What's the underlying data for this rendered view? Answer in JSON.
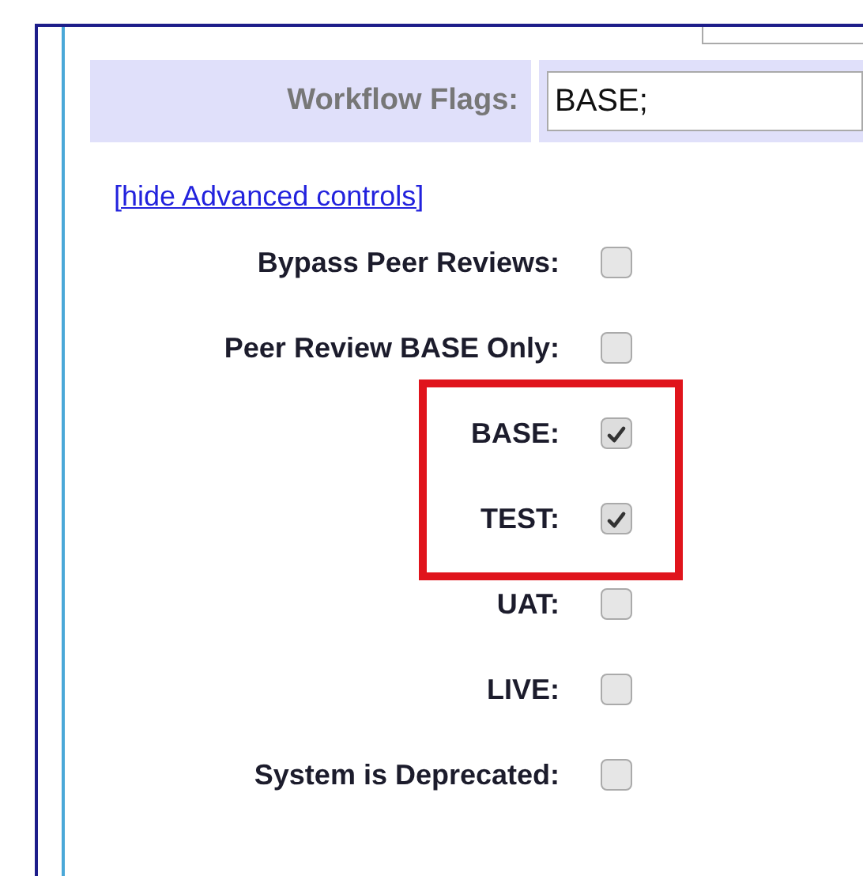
{
  "workflow_flags": {
    "label": "Workflow Flags:",
    "value": "BASE;"
  },
  "advanced_link": "[hide Advanced controls]",
  "options": [
    {
      "label": "Bypass Peer Reviews:",
      "checked": false
    },
    {
      "label": "Peer Review BASE Only:",
      "checked": false
    },
    {
      "label": "BASE:",
      "checked": true,
      "highlighted": true
    },
    {
      "label": "TEST:",
      "checked": true,
      "highlighted": true
    },
    {
      "label": "UAT:",
      "checked": false
    },
    {
      "label": "LIVE:",
      "checked": false
    },
    {
      "label": "System is Deprecated:",
      "checked": false
    }
  ]
}
